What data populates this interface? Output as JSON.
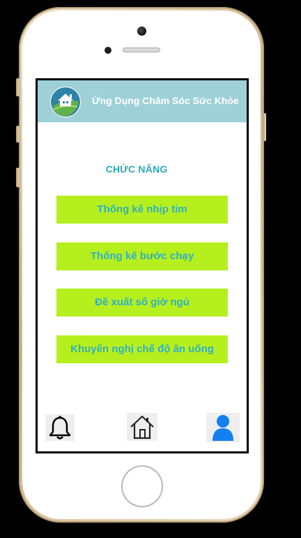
{
  "app": {
    "title": "Ứng Dụng Chăm Sóc Sức Khỏe",
    "logo_icon": "house-leaf-logo-icon"
  },
  "main": {
    "section_title": "CHỨC NĂNG",
    "menu": [
      {
        "label": "Thống kê nhịp tim"
      },
      {
        "label": "Thống kê bước chạy"
      },
      {
        "label": "Đề xuất số giờ ngủ"
      },
      {
        "label": "Khuyến nghị chế độ ăn uống"
      }
    ]
  },
  "bottom_nav": {
    "items": [
      {
        "icon": "bell-icon"
      },
      {
        "icon": "home-icon"
      },
      {
        "icon": "user-icon"
      }
    ]
  },
  "colors": {
    "header": "#9ed1d7",
    "menu_button": "#b5f01e",
    "menu_text": "#33b0c0",
    "section_title": "#2aa9b8",
    "user_icon": "#1480f0"
  }
}
